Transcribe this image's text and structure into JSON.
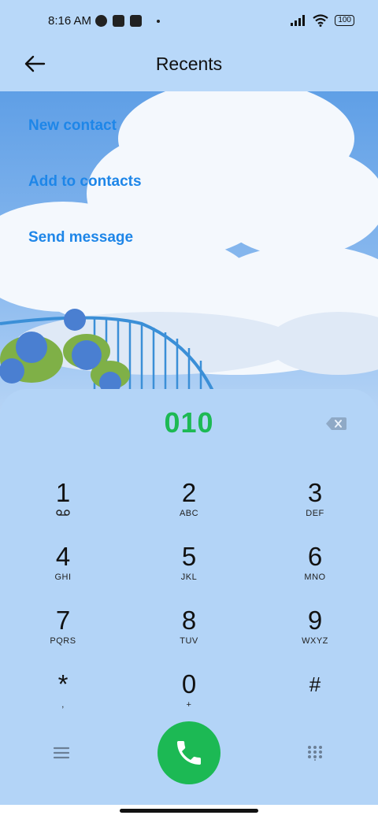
{
  "status_bar": {
    "time": "8:16 AM",
    "battery": "100"
  },
  "header": {
    "title": "Recents",
    "back_icon": "arrow-left-icon"
  },
  "actions": [
    {
      "label": "New contact"
    },
    {
      "label": "Add to contacts"
    },
    {
      "label": "Send message"
    }
  ],
  "dialer": {
    "number": "010",
    "keys": [
      {
        "digit": "1",
        "letters": ""
      },
      {
        "digit": "2",
        "letters": "ABC"
      },
      {
        "digit": "3",
        "letters": "DEF"
      },
      {
        "digit": "4",
        "letters": "GHI"
      },
      {
        "digit": "5",
        "letters": "JKL"
      },
      {
        "digit": "6",
        "letters": "MNO"
      },
      {
        "digit": "7",
        "letters": "PQRS"
      },
      {
        "digit": "8",
        "letters": "TUV"
      },
      {
        "digit": "9",
        "letters": "WXYZ"
      },
      {
        "digit": "*",
        "letters": ","
      },
      {
        "digit": "0",
        "letters": "+"
      },
      {
        "digit": "#",
        "letters": ""
      }
    ]
  },
  "colors": {
    "accent_blue": "#1e86e8",
    "dial_green": "#1db954",
    "panel": "#b3d4f7"
  }
}
